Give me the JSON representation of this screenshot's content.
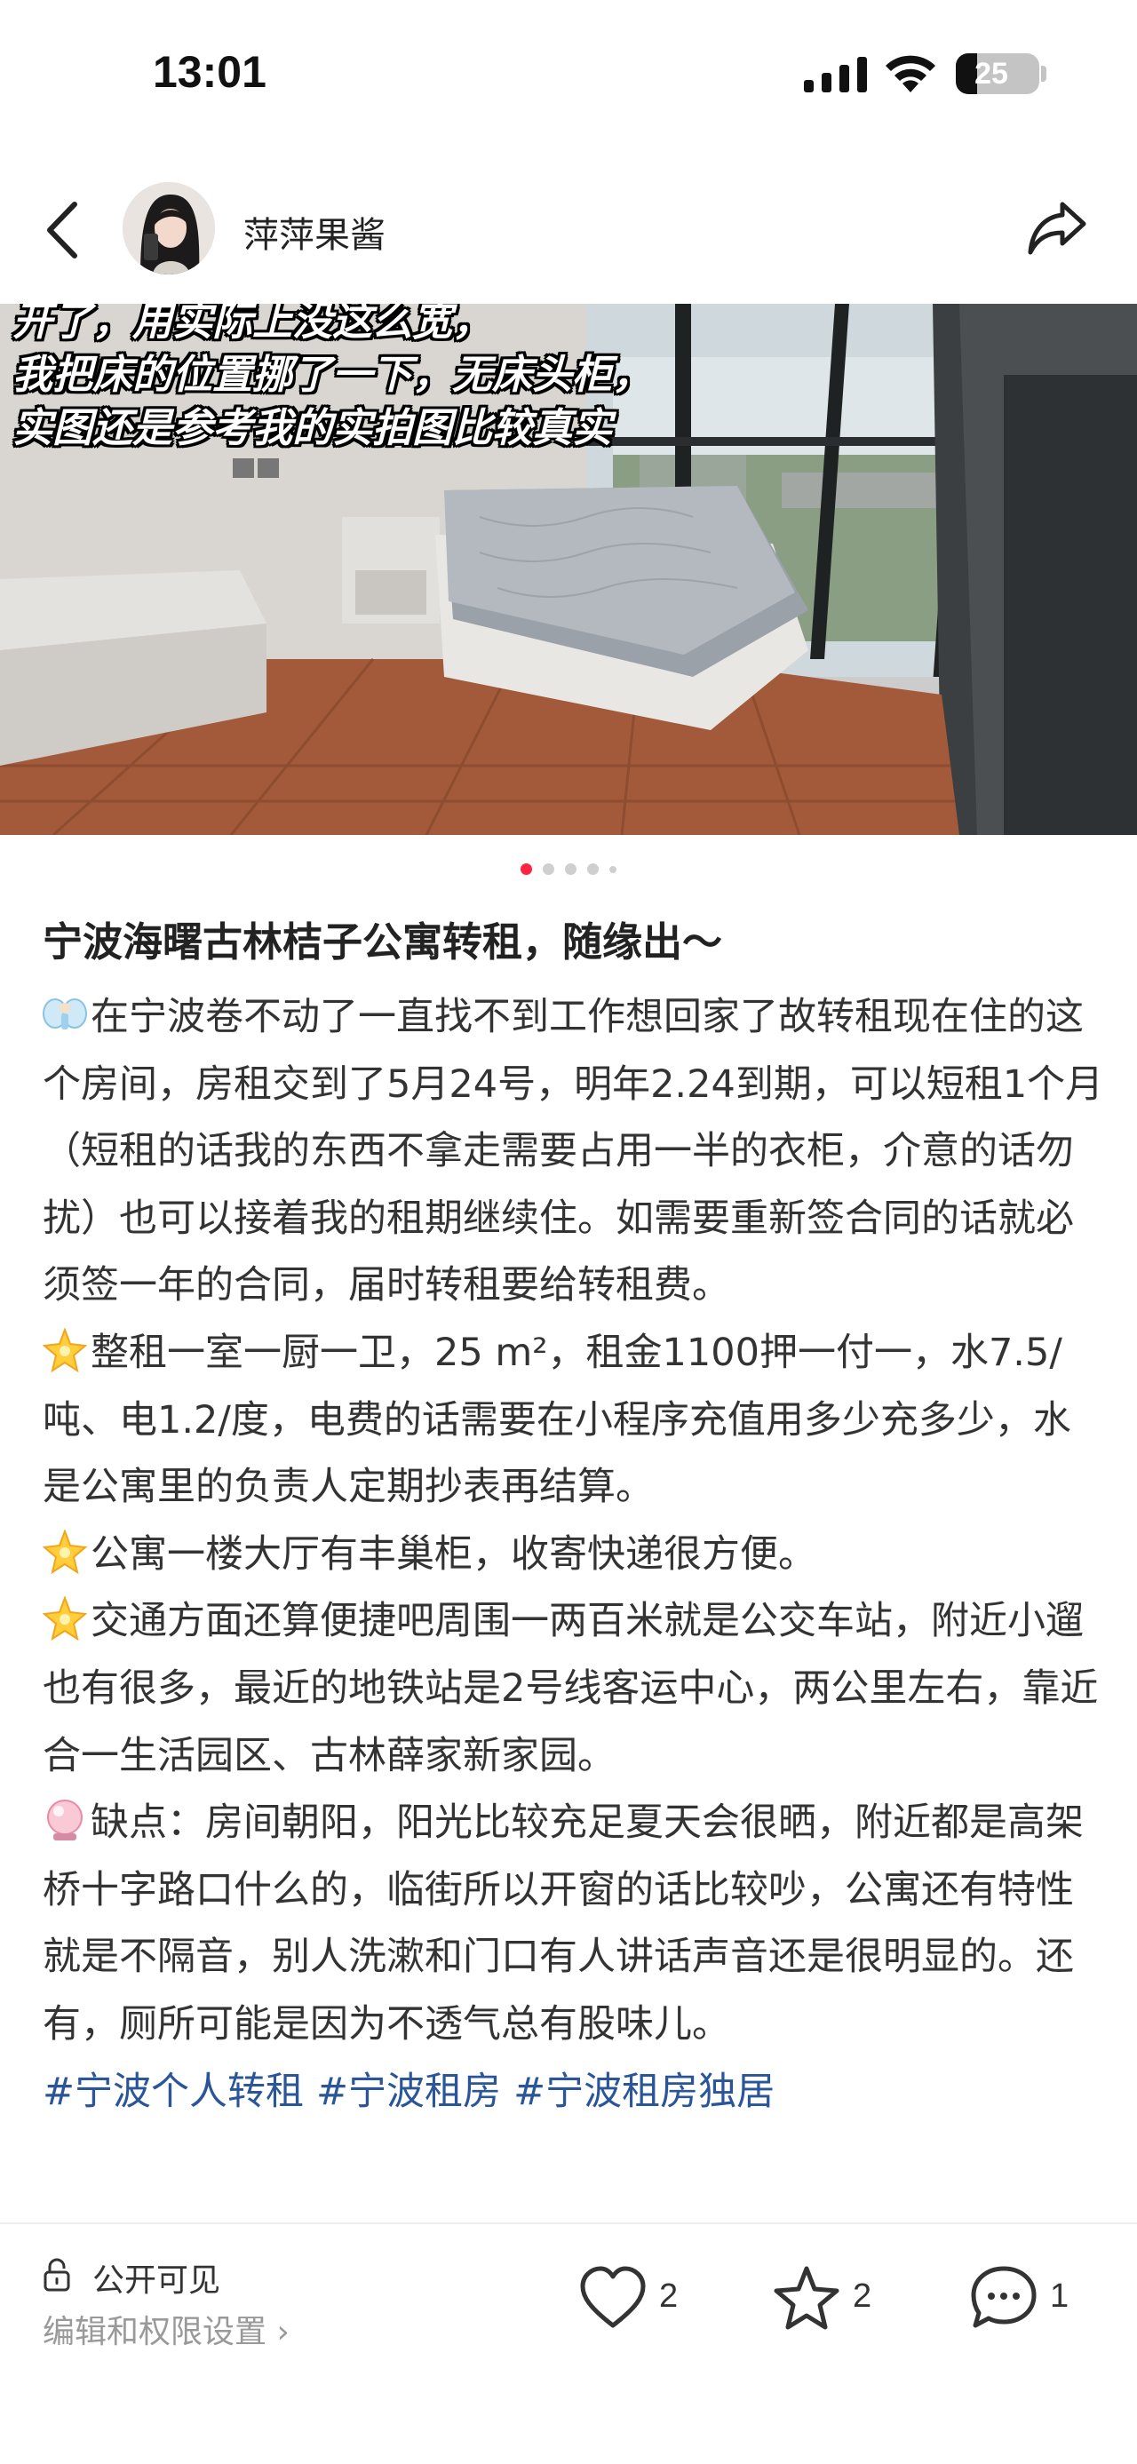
{
  "status_bar": {
    "time": "13:01",
    "battery": "25",
    "icons": [
      "signal-icon",
      "wifi-icon",
      "battery-icon"
    ]
  },
  "header": {
    "author_name": "萍萍果酱",
    "icons": [
      "back-icon",
      "share-icon"
    ]
  },
  "photo": {
    "caption_lines": [
      "开了，用实际上没这么宽，",
      "我把床的位置挪了一下，无床头柜，",
      "实图还是参考我的实拍图比较真实"
    ],
    "carousel": {
      "total": 5,
      "current": 1
    }
  },
  "note": {
    "title": "宁波海曙古林桔子公寓转租，随缘出～",
    "paragraphs": [
      {
        "icon": "fairy-emoji-icon",
        "text": "在宁波卷不动了一直找不到工作想回家了故转租现在住的这个房间，房租交到了5月24号，明年2.24到期，可以短租1个月（短租的话我的东西不拿走需要占用一半的衣柜，介意的话勿扰）也可以接着我的租期继续住。如需要重新签合同的话就必须签一年的合同，届时转租要给转租费。"
      },
      {
        "icon": "sparkle-star-emoji-icon",
        "text": "整租一室一厨一卫，25 m²，租金1100押一付一，水7.5/吨、电1.2/度，电费的话需要在小程序充值用多少充多少，水是公寓里的负责人定期抄表再结算。"
      },
      {
        "icon": "sparkle-star-emoji-icon",
        "text": "公寓一楼大厅有丰巢柜，收寄快递很方便。"
      },
      {
        "icon": "sparkle-star-emoji-icon",
        "text": "交通方面还算便捷吧周围一两百米就是公交车站，附近小遛也有很多，最近的地铁站是2号线客运中心，两公里左右，靠近合一生活园区、古林薛家新家园。"
      },
      {
        "icon": "crystal-ball-emoji-icon",
        "text": "缺点：房间朝阳，阳光比较充足夏天会很晒，附近都是高架桥十字路口什么的，临街所以开窗的话比较吵，公寓还有特性就是不隔音，别人洗漱和门口有人讲话声音还是很明显的。还有，厕所可能是因为不透气总有股味儿。"
      }
    ],
    "tags": [
      "#宁波个人转租",
      "#宁波租房",
      "#宁波租房独居"
    ]
  },
  "bottom_bar": {
    "visibility": "公开可见",
    "settings_link": "编辑和权限设置 ›",
    "likes": "2",
    "collects": "2",
    "comments": "1"
  },
  "colors": {
    "accent": "#ff2442",
    "tag": "#2a5599",
    "muted": "#999999"
  }
}
